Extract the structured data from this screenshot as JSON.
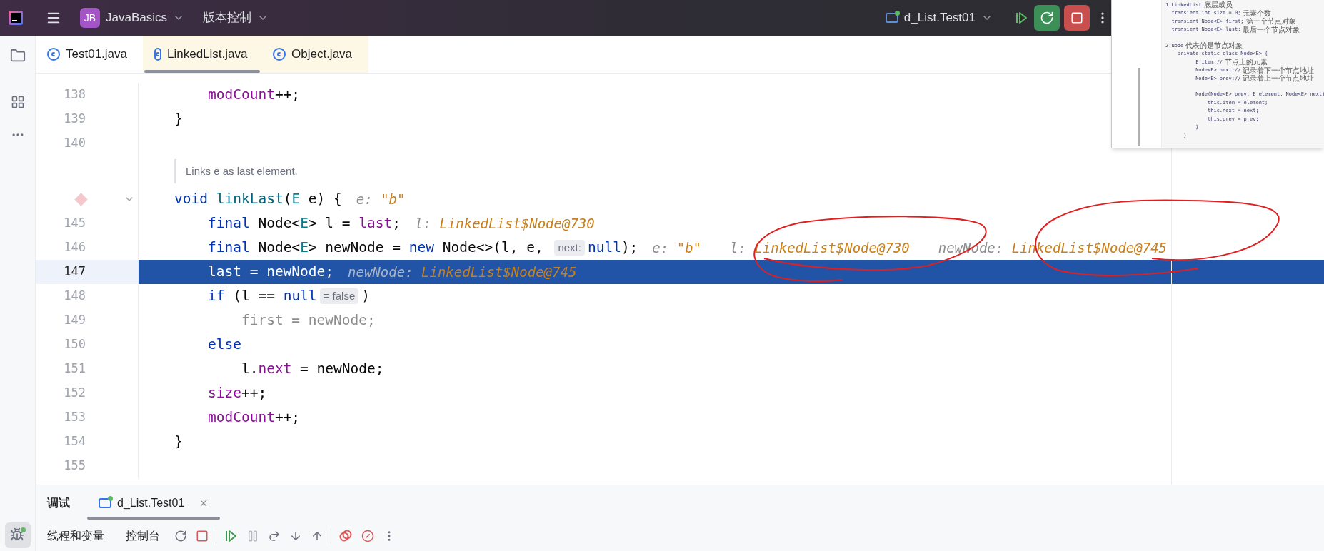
{
  "title_bar": {
    "project_badge": "JB",
    "project": "JavaBasics",
    "vcs": "版本控制",
    "run_config": "d_List.Test01"
  },
  "editor_tabs": [
    {
      "label": "Test01.java",
      "selected": false,
      "library": false
    },
    {
      "label": "LinkedList.java",
      "selected": true,
      "library": true
    },
    {
      "label": "Object.java",
      "selected": false,
      "library": true
    }
  ],
  "code_lines": [
    {
      "kind": "code",
      "number": "138",
      "breakpoint": false,
      "current": false,
      "foldable": false,
      "segments": [
        {
          "kind": "code",
          "tokens": [
            {
              "kind": "field",
              "text": "    modCount"
            },
            {
              "kind": "plain",
              "text": "++;"
            }
          ]
        }
      ]
    },
    {
      "kind": "code",
      "number": "139",
      "breakpoint": false,
      "current": false,
      "foldable": false,
      "segments": [
        {
          "kind": "code",
          "tokens": [
            {
              "kind": "plain",
              "text": "}"
            }
          ]
        }
      ]
    },
    {
      "kind": "code",
      "number": "140",
      "breakpoint": false,
      "current": false,
      "foldable": false
    },
    {
      "kind": "doc",
      "text": "Links e as last element."
    },
    {
      "kind": "code",
      "breakpoint": true,
      "current": false,
      "foldable": true,
      "segments": [
        {
          "kind": "code",
          "tokens": [
            {
              "kind": "kw",
              "text": "void "
            },
            {
              "kind": "fn",
              "text": "linkLast"
            },
            {
              "kind": "plain",
              "text": "("
            },
            {
              "kind": "type",
              "text": "E"
            },
            {
              "kind": "plain",
              "text": " e) {"
            }
          ]
        },
        {
          "kind": "hint",
          "name": "e:",
          "value": "\"b\""
        }
      ]
    },
    {
      "kind": "code",
      "number": "145",
      "breakpoint": false,
      "current": false,
      "foldable": false,
      "segments": [
        {
          "kind": "code",
          "tokens": [
            {
              "kind": "kw",
              "text": "    final"
            },
            {
              "kind": "plain",
              "text": " Node<"
            },
            {
              "kind": "type",
              "text": "E"
            },
            {
              "kind": "plain",
              "text": "> l = "
            },
            {
              "kind": "field",
              "text": "last"
            },
            {
              "kind": "plain",
              "text": ";"
            }
          ]
        },
        {
          "kind": "hint",
          "name": "l:",
          "value": "LinkedList$Node@730"
        }
      ]
    },
    {
      "kind": "code",
      "number": "146",
      "breakpoint": false,
      "current": false,
      "foldable": false,
      "segments": [
        {
          "kind": "code",
          "tokens": [
            {
              "kind": "kw",
              "text": "    final"
            },
            {
              "kind": "plain",
              "text": " Node<"
            },
            {
              "kind": "type",
              "text": "E"
            },
            {
              "kind": "plain",
              "text": "> newNode = "
            },
            {
              "kind": "kw",
              "text": "new"
            },
            {
              "kind": "plain",
              "text": " Node<>(l, e, "
            }
          ]
        },
        {
          "kind": "inlay",
          "text": "next:"
        },
        {
          "kind": "code",
          "tokens": [
            {
              "kind": "kw",
              "text": "null"
            },
            {
              "kind": "plain",
              "text": ");"
            }
          ]
        },
        {
          "kind": "hint",
          "name": "e:",
          "value": "\"b\""
        },
        {
          "kind": "hint",
          "name": "l:",
          "value": "LinkedList$Node@730"
        },
        {
          "kind": "hint",
          "name": "newNode:",
          "value": "LinkedList$Node@745"
        }
      ]
    },
    {
      "kind": "code",
      "number": "147",
      "breakpoint": false,
      "current": true,
      "foldable": false,
      "segments": [
        {
          "kind": "code",
          "tokens": [
            {
              "kind": "field",
              "text": "    last"
            },
            {
              "kind": "plain",
              "text": " = newNode;"
            }
          ]
        },
        {
          "kind": "hint",
          "name": "newNode:",
          "value": "LinkedList$Node@745"
        }
      ]
    },
    {
      "kind": "code",
      "number": "148",
      "breakpoint": false,
      "current": false,
      "foldable": false,
      "segments": [
        {
          "kind": "code",
          "tokens": [
            {
              "kind": "kw",
              "text": "    if"
            },
            {
              "kind": "plain",
              "text": " (l == "
            },
            {
              "kind": "kw",
              "text": "null"
            }
          ]
        },
        {
          "kind": "inlay",
          "text": "= false"
        },
        {
          "kind": "code",
          "tokens": [
            {
              "kind": "plain",
              "text": ")"
            }
          ]
        }
      ]
    },
    {
      "kind": "code",
      "number": "149",
      "breakpoint": false,
      "current": false,
      "foldable": false,
      "segments": [
        {
          "kind": "code",
          "tokens": [
            {
              "kind": "muted",
              "text": "        first = newNode;"
            }
          ]
        }
      ]
    },
    {
      "kind": "code",
      "number": "150",
      "breakpoint": false,
      "current": false,
      "foldable": false,
      "segments": [
        {
          "kind": "code",
          "tokens": [
            {
              "kind": "kw",
              "text": "    else"
            }
          ]
        }
      ]
    },
    {
      "kind": "code",
      "number": "151",
      "breakpoint": false,
      "current": false,
      "foldable": false,
      "segments": [
        {
          "kind": "code",
          "tokens": [
            {
              "kind": "plain",
              "text": "        l."
            },
            {
              "kind": "field",
              "text": "next"
            },
            {
              "kind": "plain",
              "text": " = newNode;"
            }
          ]
        }
      ]
    },
    {
      "kind": "code",
      "number": "152",
      "breakpoint": false,
      "current": false,
      "foldable": false,
      "segments": [
        {
          "kind": "code",
          "tokens": [
            {
              "kind": "field",
              "text": "    size"
            },
            {
              "kind": "plain",
              "text": "++;"
            }
          ]
        }
      ]
    },
    {
      "kind": "code",
      "number": "153",
      "breakpoint": false,
      "current": false,
      "foldable": false,
      "segments": [
        {
          "kind": "code",
          "tokens": [
            {
              "kind": "field",
              "text": "    modCount"
            },
            {
              "kind": "plain",
              "text": "++;"
            }
          ]
        }
      ]
    },
    {
      "kind": "code",
      "number": "154",
      "breakpoint": false,
      "current": false,
      "foldable": false,
      "segments": [
        {
          "kind": "code",
          "tokens": [
            {
              "kind": "plain",
              "text": "}"
            }
          ]
        }
      ]
    },
    {
      "kind": "code",
      "number": "155",
      "breakpoint": false,
      "current": false,
      "foldable": false
    }
  ],
  "bottom_panel": {
    "title": "调试",
    "tabs": [
      {
        "label": "d_List.Test01",
        "selected": true
      }
    ],
    "views": [
      {
        "label": "线程和变量"
      },
      {
        "label": "控制台"
      }
    ]
  },
  "pasted_screenshot": {
    "blocks": [
      {
        "lines": [
          {
            "code": "1.LinkedList",
            "comment": "底层成员"
          },
          {
            "code": "  transient int size = 0;",
            "comment": "元素个数"
          },
          {
            "code": "  transient Node<E> first;",
            "comment": "第一个节点对象"
          },
          {
            "code": "  transient Node<E> last;",
            "comment": "最后一个节点对象"
          }
        ]
      },
      {
        "lines": [
          {
            "code": "2.Node",
            "comment": "代表的是节点对象"
          },
          {
            "code": "    private static class Node<E> {"
          },
          {
            "code": "          E item;//",
            "comment": "节点上的元素"
          },
          {
            "code": "          Node<E> next;//",
            "comment": "记录着下一个节点地址"
          },
          {
            "code": "          Node<E> prev;//",
            "comment": "记录着上一个节点地址"
          }
        ]
      },
      {
        "lines": [
          {
            "code": "          Node(Node<E> prev, E element, Node<E> next)"
          },
          {
            "code": "              this.item = element;"
          },
          {
            "code": "              this.next = next;"
          },
          {
            "code": "              this.prev = prev;"
          },
          {
            "code": "          }"
          },
          {
            "code": "      }"
          }
        ]
      }
    ]
  }
}
